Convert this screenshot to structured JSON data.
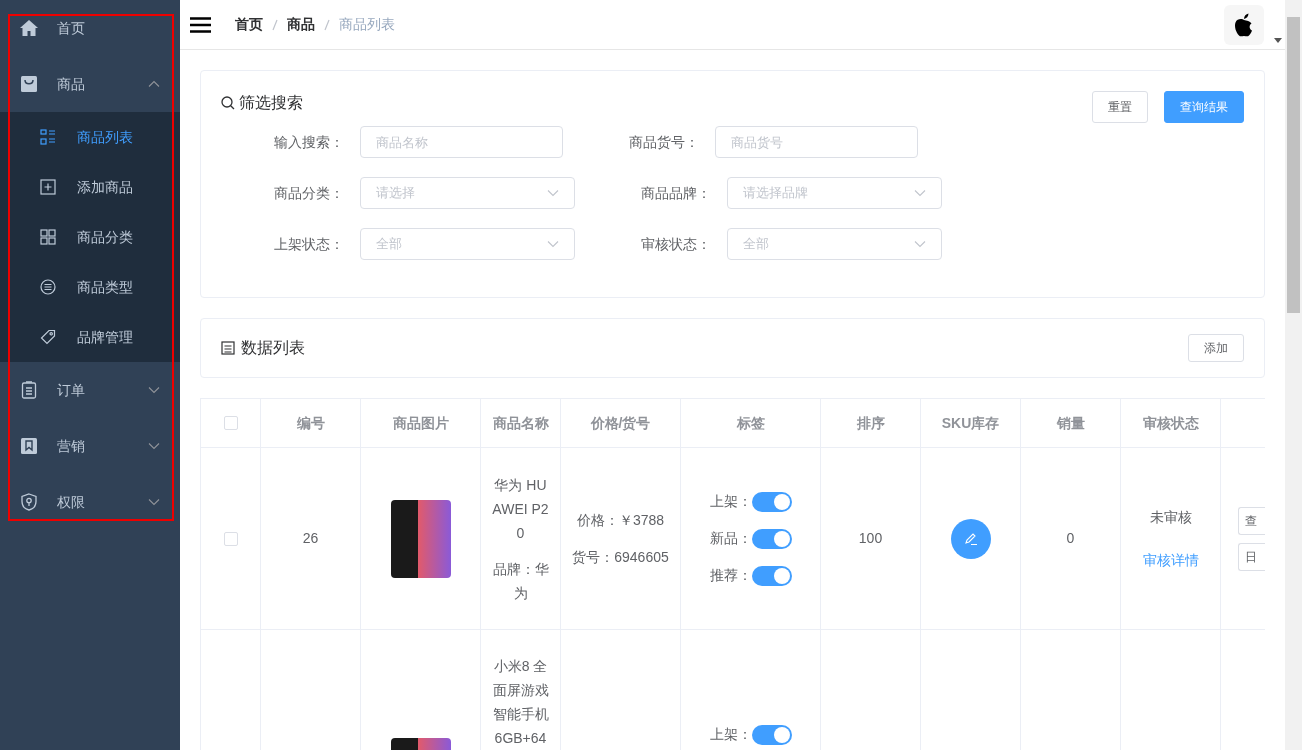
{
  "sidebar": {
    "items": [
      {
        "label": "首页"
      },
      {
        "label": "商品",
        "expanded": true,
        "children": [
          {
            "label": "商品列表",
            "selected": true
          },
          {
            "label": "添加商品",
            "selected": false
          },
          {
            "label": "商品分类",
            "selected": false
          },
          {
            "label": "商品类型",
            "selected": false
          },
          {
            "label": "品牌管理",
            "selected": false
          }
        ]
      },
      {
        "label": "订单",
        "expanded": false
      },
      {
        "label": "营销",
        "expanded": false
      },
      {
        "label": "权限",
        "expanded": false
      }
    ]
  },
  "breadcrumb": [
    {
      "label": "首页",
      "current": false
    },
    {
      "label": "商品",
      "current": false
    },
    {
      "label": "商品列表",
      "current": true
    }
  ],
  "filter": {
    "title": "筛选搜索",
    "buttons": [
      {
        "label": "重置",
        "primary": false
      },
      {
        "label": "查询结果",
        "primary": true
      }
    ],
    "rows": [
      [
        {
          "label": "输入搜索：",
          "kind": "input",
          "placeholder": "商品名称"
        },
        {
          "label": "商品货号：",
          "kind": "input",
          "placeholder": "商品货号"
        }
      ],
      [
        {
          "label": "商品分类：",
          "kind": "select",
          "placeholder": "请选择"
        },
        {
          "label": "商品品牌：",
          "kind": "select",
          "placeholder": "请选择品牌"
        }
      ],
      [
        {
          "label": "上架状态：",
          "kind": "select",
          "placeholder": "全部"
        },
        {
          "label": "审核状态：",
          "kind": "select",
          "placeholder": "全部"
        }
      ]
    ]
  },
  "data_list": {
    "title": "数据列表",
    "add_button": "添加"
  },
  "table": {
    "select_all": false,
    "columns": [
      "编号",
      "商品图片",
      "商品名称",
      "价格/货号",
      "标签",
      "排序",
      "SKU库存",
      "销量",
      "审核状态"
    ],
    "rows": [
      {
        "checked": false,
        "id": "26",
        "name": "华为 HUAWEI P20",
        "brand": "品牌：华为",
        "price": "价格：￥3788",
        "sku": "货号：6946605",
        "tags": [
          {
            "label": "上架：",
            "on": true
          },
          {
            "label": "新品：",
            "on": true
          },
          {
            "label": "推荐：",
            "on": true
          }
        ],
        "sort": "100",
        "sales": "0",
        "status": "未审核",
        "status_link": "审核详情",
        "actions": [
          "查",
          "日"
        ]
      },
      {
        "name": "小米8 全面屏游戏智能手机6GB+64",
        "tags": [
          {
            "label": "上架：",
            "on": true
          }
        ]
      }
    ]
  }
}
